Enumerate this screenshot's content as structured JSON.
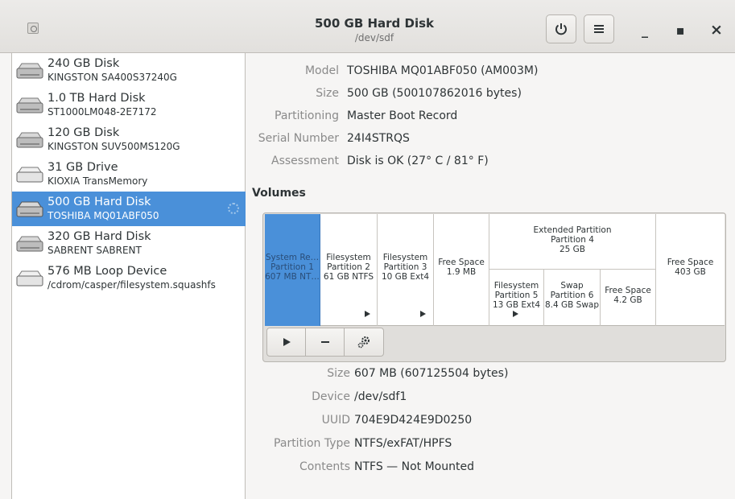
{
  "header": {
    "title": "500 GB Hard Disk",
    "subtitle": "/dev/sdf",
    "power_icon": "power-icon",
    "menu_icon": "hamburger-menu-icon",
    "minimize_label": "_",
    "maximize_label": "▪",
    "close_label": "×"
  },
  "sidebar": {
    "devices": [
      {
        "name": "240 GB Disk",
        "model": "KINGSTON SA400S37240G",
        "icon": "hard-disk-icon"
      },
      {
        "name": "1.0 TB Hard Disk",
        "model": "ST1000LM048-2E7172",
        "icon": "hard-disk-icon"
      },
      {
        "name": "120 GB Disk",
        "model": "KINGSTON SUV500MS120G",
        "icon": "hard-disk-icon"
      },
      {
        "name": "31 GB Drive",
        "model": "KIOXIA TransMemory",
        "icon": "usb-drive-icon"
      },
      {
        "name": "500 GB Hard Disk",
        "model": "TOSHIBA MQ01ABF050",
        "icon": "hard-disk-icon",
        "selected": true
      },
      {
        "name": "320 GB Hard Disk",
        "model": "SABRENT SABRENT",
        "icon": "hard-disk-icon"
      },
      {
        "name": "576 MB Loop Device",
        "model": "/cdrom/casper/filesystem.squashfs",
        "icon": "loop-device-icon"
      }
    ]
  },
  "disk_info": {
    "model_label": "Model",
    "model_value": "TOSHIBA MQ01ABF050 (AM003M)",
    "size_label": "Size",
    "size_value": "500 GB (500107862016 bytes)",
    "partitioning_label": "Partitioning",
    "partitioning_value": "Master Boot Record",
    "serial_label": "Serial Number",
    "serial_value": "24I4STRQS",
    "assessment_label": "Assessment",
    "assessment_value": "Disk is OK (27° C / 81° F)"
  },
  "volumes": {
    "title": "Volumes",
    "cells": {
      "p1": [
        "System Re…",
        "Partition 1",
        "607 MB NT…"
      ],
      "p2": [
        "Filesystem",
        "Partition 2",
        "61 GB NTFS"
      ],
      "p3": [
        "Filesystem",
        "Partition 3",
        "10 GB Ext4"
      ],
      "free1": [
        "Free Space",
        "1.9 MB"
      ],
      "extended": [
        "Extended Partition",
        "Partition 4",
        "25 GB"
      ],
      "p5": [
        "Filesystem",
        "Partition 5",
        "13 GB Ext4"
      ],
      "p6": [
        "Swap",
        "Partition 6",
        "8.4 GB Swap"
      ],
      "free2": [
        "Free Space",
        "4.2 GB"
      ],
      "free3": [
        "Free Space",
        "403 GB"
      ]
    },
    "toolbar": {
      "mount_icon": "play-icon",
      "remove_icon": "minus-icon",
      "settings_icon": "gears-icon"
    }
  },
  "partition_info": {
    "size_label": "Size",
    "size_value": "607 MB (607125504 bytes)",
    "device_label": "Device",
    "device_value": "/dev/sdf1",
    "uuid_label": "UUID",
    "uuid_value": "704E9D424E9D0250",
    "type_label": "Partition Type",
    "type_value": "NTFS/exFAT/HPFS",
    "contents_label": "Contents",
    "contents_value": "NTFS — Not Mounted"
  },
  "colors": {
    "selection": "#4a90d9",
    "sidebar_bg": "#ffffff",
    "window_bg": "#f6f5f4"
  }
}
